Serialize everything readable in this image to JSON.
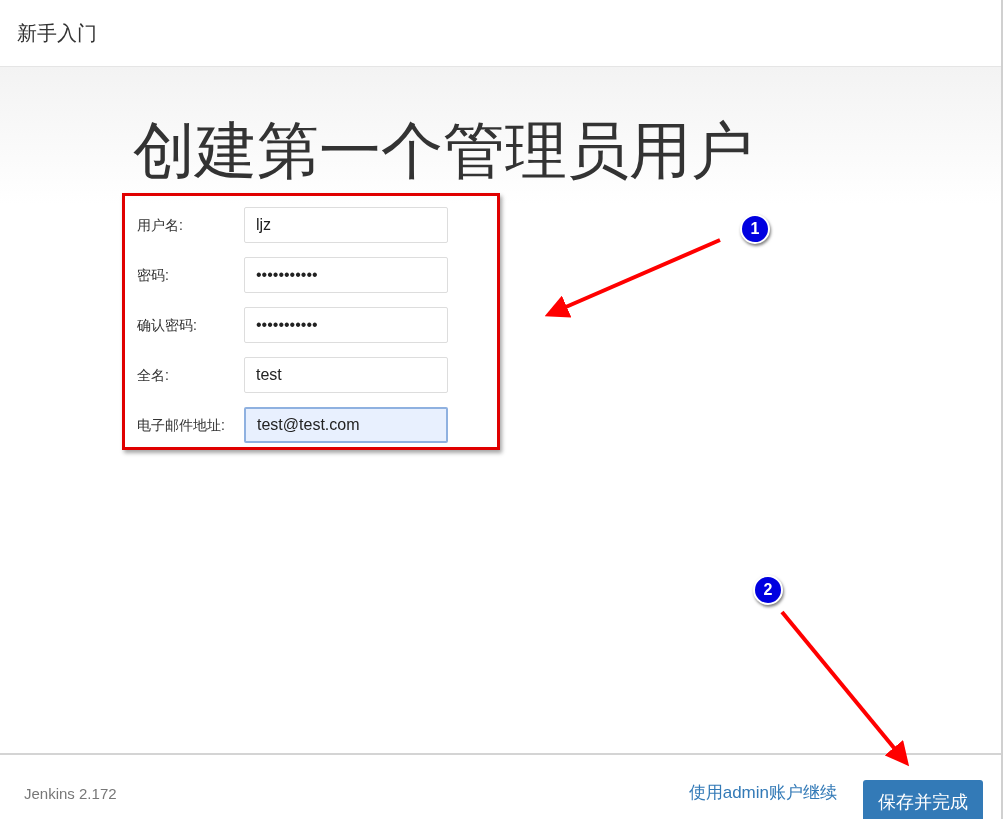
{
  "header": {
    "title": "新手入门"
  },
  "heading": "创建第一个管理员用户",
  "fields": [
    {
      "label": "用户名:",
      "value": "ljz",
      "focused": false
    },
    {
      "label": "密码:",
      "value": "•••••••••••",
      "focused": false
    },
    {
      "label": "确认密码:",
      "value": "•••••••••••",
      "focused": false
    },
    {
      "label": "全名:",
      "value": "test",
      "focused": false
    },
    {
      "label": "电子邮件地址:",
      "value": "test@test.com",
      "focused": true
    }
  ],
  "annotations": [
    {
      "number": "1"
    },
    {
      "number": "2"
    }
  ],
  "footer": {
    "version": "Jenkins 2.172",
    "link": "使用admin账户继续",
    "button": "保存并完成"
  }
}
